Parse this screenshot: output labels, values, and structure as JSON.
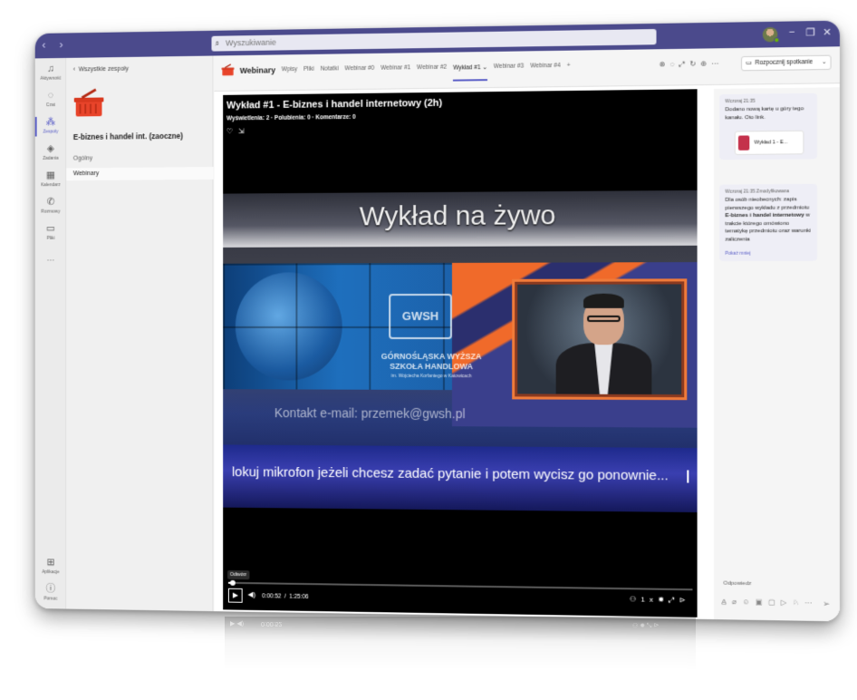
{
  "titlebar": {
    "search_placeholder": "Wyszukiwanie",
    "accent": "#4b4a8c"
  },
  "rail": {
    "items": [
      {
        "label": "Aktywność",
        "icon": "bell-icon"
      },
      {
        "label": "Czat",
        "icon": "chat-icon"
      },
      {
        "label": "Zespoły",
        "icon": "teams-icon"
      },
      {
        "label": "Zadania",
        "icon": "tasks-icon"
      },
      {
        "label": "Kalendarz",
        "icon": "calendar-icon"
      },
      {
        "label": "Rozmowy",
        "icon": "phone-icon"
      },
      {
        "label": "Pliki",
        "icon": "file-icon"
      }
    ],
    "more": "···",
    "apps_label": "Aplikacje",
    "help_label": "Pomoc"
  },
  "team_panel": {
    "back_label": "Wszystkie zespoły",
    "team_name": "E-biznes i handel int. (zaoczne)",
    "channels": [
      "Ogólny",
      "Webinary"
    ]
  },
  "header": {
    "channel_title": "Webinary",
    "tabs": [
      "Wpisy",
      "Pliki",
      "Notatki",
      "Webinar #0",
      "Webinar #1",
      "Webinar #2",
      "Wykład #1",
      "Webinar #3",
      "Webinar #4",
      "+"
    ],
    "active_tab": "Wykład #1",
    "meet_button": "Rozpocznij spotkanie"
  },
  "player": {
    "title": "Wykład #1 - E-biznes i handel internetowy (2h)",
    "stats": "Wyświetlenia: 2 · Polubienia: 0 · Komentarze: 0",
    "overlay_title": "Wykład na żywo",
    "school_name": "GÓRNOŚLĄSKA WYŻSZA SZKOŁA HANDLOWA",
    "school_sub": "im. Wojciecha Korfantego w Katowicach",
    "logo_text": "GWSH",
    "contact": "Kontakt e-mail: przemek@gwsh.pl",
    "ticker": "lokuj mikrofon jeżeli chcesz zadać pytanie i potem wycisz go ponownie...",
    "tooltip": "Odtwórz",
    "current_time": "0:00:52",
    "separator": "/",
    "duration": "1:25:06",
    "progress": 0.0102,
    "speed": "1x"
  },
  "conversation": {
    "messages": [
      {
        "meta": "Wczoraj 21:35",
        "body": "Dodano nową kartę u góry tego kanału. Oto link."
      },
      {
        "meta": "Wczoraj 21:35   Zmodyfikowana",
        "body_pre": "Dla osób nieobecnych: zapis pierwszego wykładu z przedmiotu ",
        "body_bold": "E-biznes i handel internetowy",
        "body_post": " w trakcie którego omówiono tematykę przedmiotu oraz warunki zaliczenia"
      }
    ],
    "card_label": "Wykład 1 - E...",
    "show_less": "Pokaż mniej",
    "reply_label": "Odpowiedz"
  }
}
